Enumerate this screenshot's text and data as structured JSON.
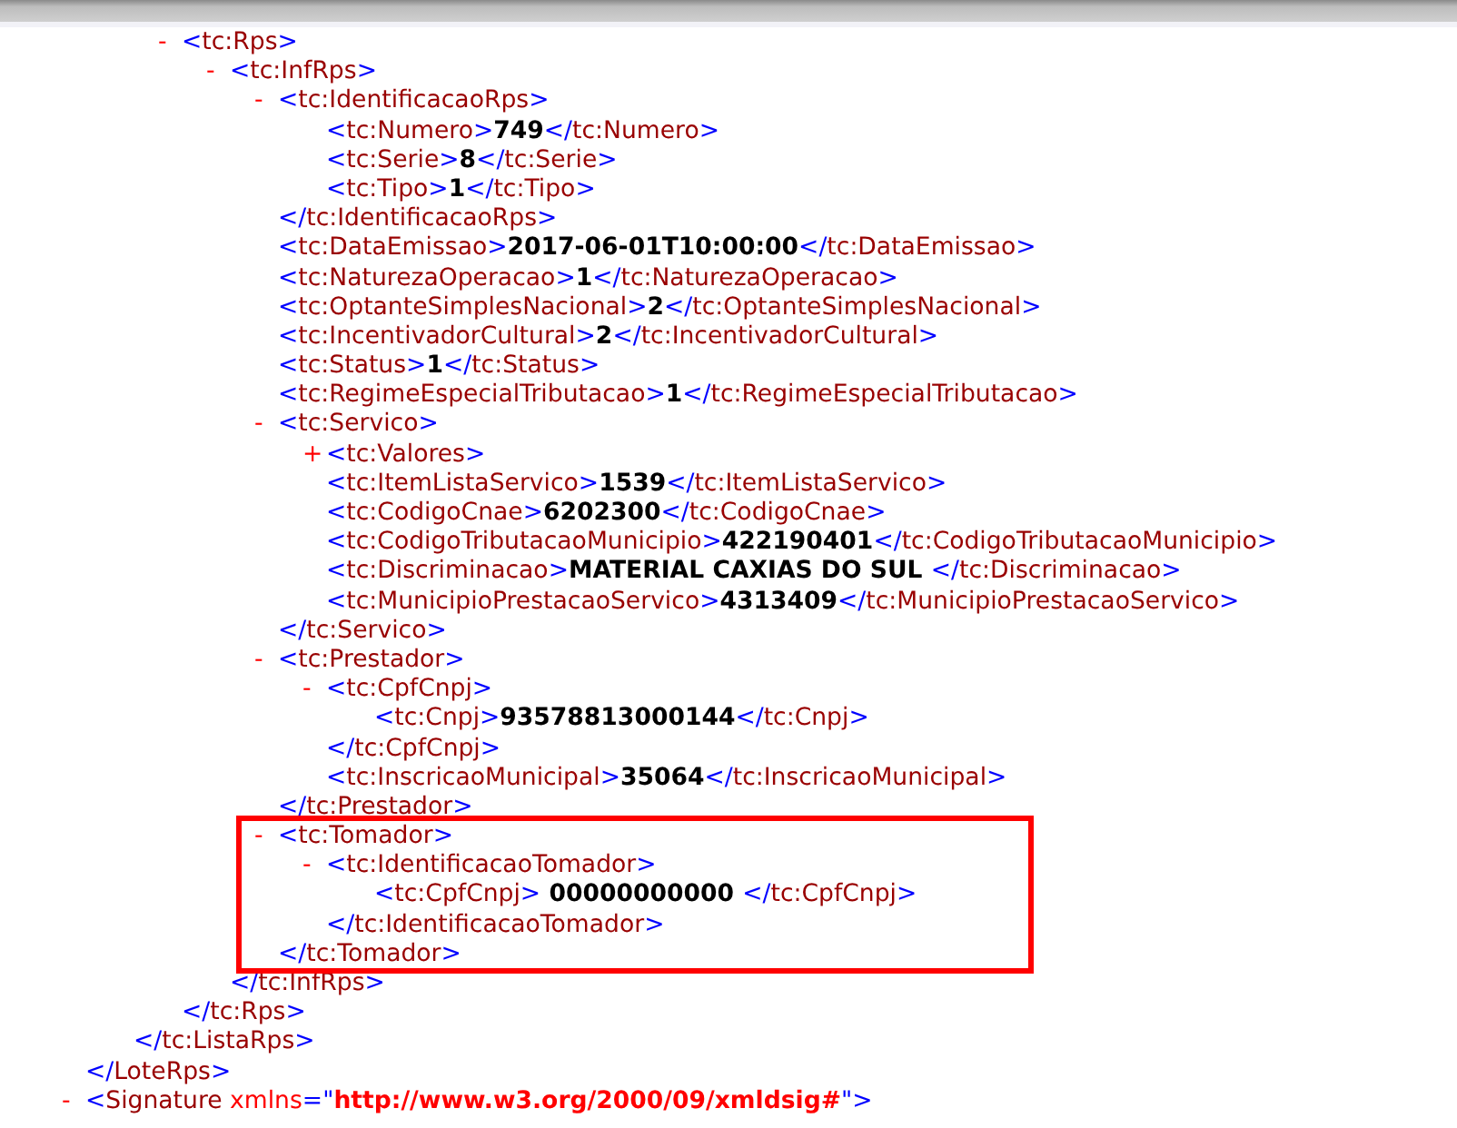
{
  "xml_tree": [
    {
      "kind": "element",
      "close": "</LoteRps>",
      "children": [
        {
          "kind": "element",
          "close": "</tc:ListaRps>",
          "children": [
            {
              "kind": "element",
              "toggle": "-",
              "open": "<tc:Rps>",
              "close": "</tc:Rps>",
              "children": [
                {
                  "kind": "element",
                  "toggle": "-",
                  "open": "<tc:InfRps>",
                  "close": "</tc:InfRps>",
                  "children": [
                    {
                      "kind": "element",
                      "toggle": "-",
                      "open": "<tc:IdentificacaoRps>",
                      "close": "</tc:IdentificacaoRps>",
                      "children": [
                        {
                          "kind": "leaf",
                          "open": "<tc:Numero>",
                          "value": "749",
                          "close": "</tc:Numero>"
                        },
                        {
                          "kind": "leaf",
                          "open": "<tc:Serie>",
                          "value": "8",
                          "close": "</tc:Serie>"
                        },
                        {
                          "kind": "leaf",
                          "open": "<tc:Tipo>",
                          "value": "1",
                          "close": "</tc:Tipo>"
                        }
                      ]
                    },
                    {
                      "kind": "leaf",
                      "open": "<tc:DataEmissao>",
                      "value": "2017-06-01T10:00:00",
                      "close": "</tc:DataEmissao>"
                    },
                    {
                      "kind": "leaf",
                      "open": "<tc:NaturezaOperacao>",
                      "value": "1",
                      "close": "</tc:NaturezaOperacao>"
                    },
                    {
                      "kind": "leaf",
                      "open": "<tc:OptanteSimplesNacional>",
                      "value": "2",
                      "close": "</tc:OptanteSimplesNacional>"
                    },
                    {
                      "kind": "leaf",
                      "open": "<tc:IncentivadorCultural>",
                      "value": "2",
                      "close": "</tc:IncentivadorCultural>"
                    },
                    {
                      "kind": "leaf",
                      "open": "<tc:Status>",
                      "value": "1",
                      "close": "</tc:Status>"
                    },
                    {
                      "kind": "leaf",
                      "open": "<tc:RegimeEspecialTributacao>",
                      "value": "1",
                      "close": "</tc:RegimeEspecialTributacao>"
                    },
                    {
                      "kind": "element",
                      "toggle": "-",
                      "open": "<tc:Servico>",
                      "close": "</tc:Servico>",
                      "children": [
                        {
                          "kind": "element",
                          "toggle": "+",
                          "open": "<tc:Valores>"
                        },
                        {
                          "kind": "leaf",
                          "open": "<tc:ItemListaServico>",
                          "value": "1539",
                          "close": "</tc:ItemListaServico>"
                        },
                        {
                          "kind": "leaf",
                          "open": "<tc:CodigoCnae>",
                          "value": "6202300",
                          "close": "</tc:CodigoCnae>"
                        },
                        {
                          "kind": "leaf",
                          "open": "<tc:CodigoTributacaoMunicipio>",
                          "value": "422190401",
                          "close": "</tc:CodigoTributacaoMunicipio>"
                        },
                        {
                          "kind": "leaf",
                          "open": "<tc:Discriminacao>",
                          "value": "MATERIAL CAXIAS DO SUL ",
                          "close": "</tc:Discriminacao>"
                        },
                        {
                          "kind": "leaf",
                          "open": "<tc:MunicipioPrestacaoServico>",
                          "value": "4313409",
                          "close": "</tc:MunicipioPrestacaoServico>"
                        }
                      ]
                    },
                    {
                      "kind": "element",
                      "toggle": "-",
                      "open": "<tc:Prestador>",
                      "close": "</tc:Prestador>",
                      "children": [
                        {
                          "kind": "element",
                          "toggle": "-",
                          "open": "<tc:CpfCnpj>",
                          "close": "</tc:CpfCnpj>",
                          "children": [
                            {
                              "kind": "leaf",
                              "open": "<tc:Cnpj>",
                              "value": "93578813000144",
                              "close": "</tc:Cnpj>"
                            }
                          ]
                        },
                        {
                          "kind": "leaf",
                          "open": "<tc:InscricaoMunicipal>",
                          "value": "35064",
                          "close": "</tc:InscricaoMunicipal>"
                        }
                      ]
                    },
                    {
                      "kind": "element",
                      "toggle": "-",
                      "open": "<tc:Tomador>",
                      "close": "</tc:Tomador>",
                      "highlighted": true,
                      "children": [
                        {
                          "kind": "element",
                          "toggle": "-",
                          "open": "<tc:IdentificacaoTomador>",
                          "close": "</tc:IdentificacaoTomador>",
                          "children": [
                            {
                              "kind": "leaf",
                              "open": "<tc:CpfCnpj>",
                              "value": " 00000000000 ",
                              "close": "</tc:CpfCnpj>"
                            }
                          ]
                        }
                      ]
                    }
                  ]
                }
              ]
            }
          ]
        }
      ]
    },
    {
      "kind": "element",
      "toggle": "-",
      "open": "<Signature xmlns=\"http://www.w3.org/2000/09/xmldsig#\">"
    }
  ]
}
